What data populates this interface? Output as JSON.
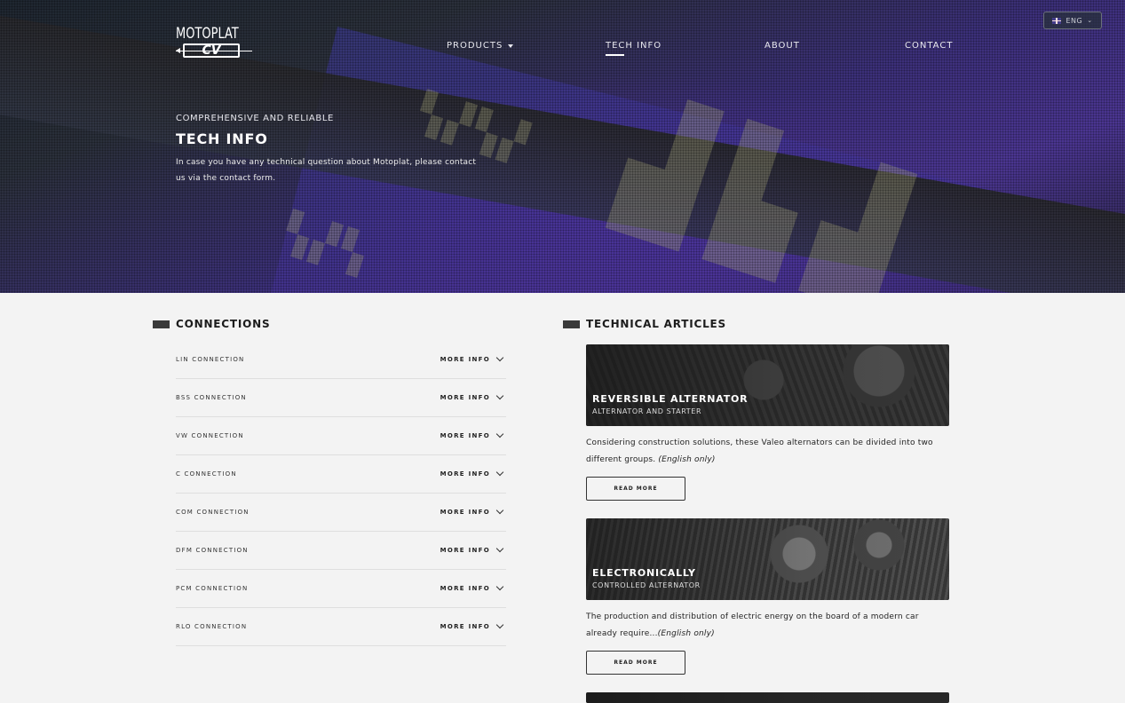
{
  "header": {
    "logo_top": "MOTOPLAT",
    "logo_bottom": "CV",
    "language": "ENG",
    "nav": {
      "products": "PRODUCTS",
      "tech_info": "TECH INFO",
      "about": "ABOUT",
      "contact": "CONTACT"
    }
  },
  "hero": {
    "kicker": "COMPREHENSIVE AND RELIABLE",
    "title": "TECH INFO",
    "description": "In case you have any technical question about Motoplat, please contact us via the contact form."
  },
  "connections": {
    "heading": "CONNECTIONS",
    "more_label": "MORE INFO",
    "items": [
      "LIN CONNECTION",
      "BSS CONNECTION",
      "VW CONNECTION",
      "C CONNECTION",
      "COM CONNECTION",
      "DFM CONNECTION",
      "PCM CONNECTION",
      "RLO CONNECTION"
    ]
  },
  "articles": {
    "heading": "TECHNICAL ARTICLES",
    "read_more": "READ MORE",
    "items": [
      {
        "title": "REVERSIBLE ALTERNATOR",
        "subtitle": "ALTERNATOR AND STARTER",
        "text": "Considering construction solutions, these Valeo alternators can be divided into two different groups. ",
        "note": "(English only)"
      },
      {
        "title": "ELECTRONICALLY",
        "subtitle": "CONTROLLED ALTERNATOR",
        "text": "The production and distribution of electric energy on the board of a modern car already require...",
        "note": "(English only)"
      }
    ]
  }
}
